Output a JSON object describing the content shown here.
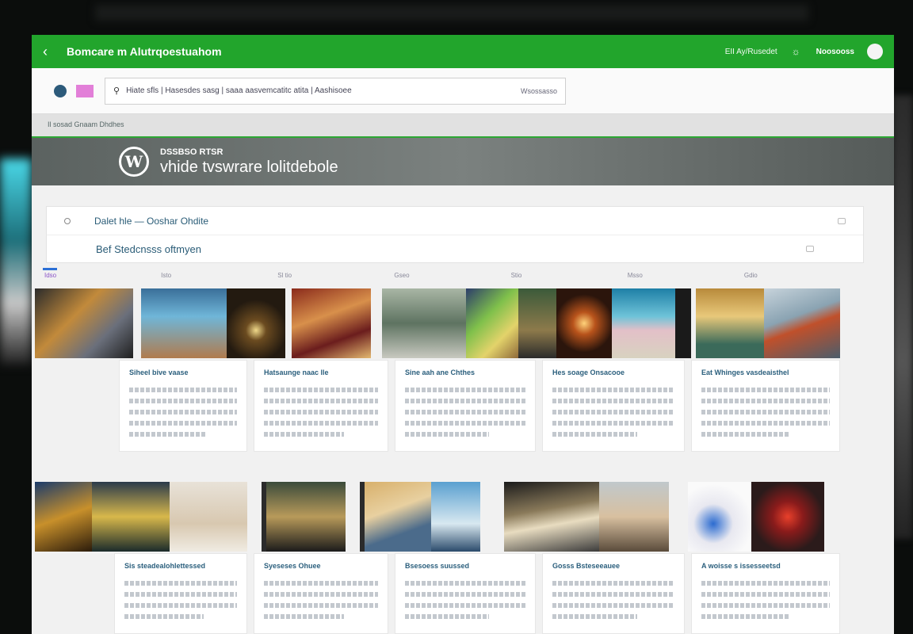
{
  "app_bar": {
    "back_icon": "chevron-left-icon",
    "title": "Bomcare m Alutrqoestuahom",
    "stat_text": "EII Ay/Rusedet",
    "user_label": "Noosooss"
  },
  "search": {
    "text": "Hiate sfls | Hasesdes sasg | saaa aasvemcatitc atita | Aashisoee",
    "right_text": "Wsossasso"
  },
  "breadcrumb": {
    "text": "Il sosad Gnaam Dhdhes"
  },
  "banner": {
    "small_title": "DSSBSO RTSR",
    "big_title": "vhide tvswrare lolitdebole"
  },
  "panel": {
    "row1_text": "Dalet hle — Ooshar Ohdite",
    "row2_text": "Bef Stedcnsss oftmyen"
  },
  "gallery": {
    "tabs": [
      "Idso",
      "Isto",
      "Sl tio",
      "Gseo",
      "Stio",
      "Msso",
      "Gdio"
    ],
    "cards_row1": [
      {
        "title": "Siheel bive vaase"
      },
      {
        "title": "Hatsaunge naac lle"
      },
      {
        "title": "Sine aah ane Chthes"
      },
      {
        "title": "Hes soage Onsacooe"
      },
      {
        "title": "Eat Whinges vasdeaisthel"
      }
    ],
    "cards_row2": [
      {
        "title": "Sis steadealohlettessed"
      },
      {
        "title": "Syeseses Ohuee"
      },
      {
        "title": "Bsesoess suussed"
      },
      {
        "title": "Gosss Bsteseeauee"
      },
      {
        "title": "A woisse s issesseetsd"
      }
    ]
  },
  "colors": {
    "accent_green": "#22a52c",
    "link_blue": "#2b5f7d",
    "tab_highlight": "#8a53c7"
  }
}
